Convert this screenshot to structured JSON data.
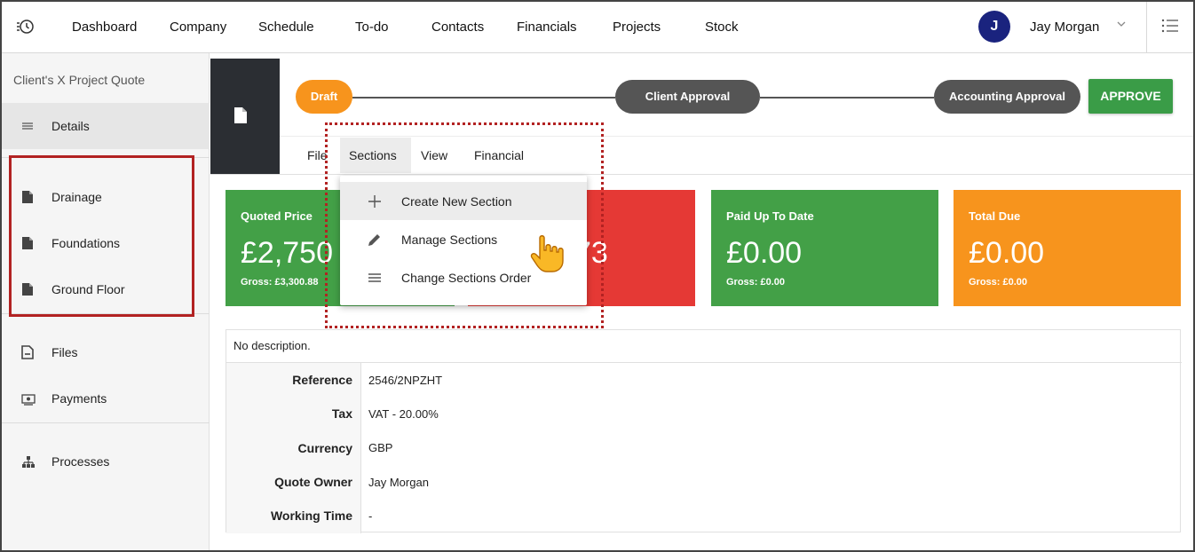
{
  "topbar": {
    "nav": [
      "Dashboard",
      "Company",
      "Schedule",
      "To-do",
      "Contacts",
      "Financials",
      "Projects",
      "Stock"
    ],
    "avatar_initial": "J",
    "user_name": "Jay Morgan",
    "icons": {
      "history": "history-icon",
      "user_menu": "chevron-down-icon",
      "app_menu": "list-menu-icon"
    }
  },
  "sidebar": {
    "project_title": "Client's X Project Quote",
    "details_label": "Details",
    "sections": [
      "Drainage",
      "Foundations",
      "Ground Floor"
    ],
    "files_label": "Files",
    "payments_label": "Payments",
    "processes_label": "Processes"
  },
  "workflow": {
    "stages": [
      "Draft",
      "Client Approval",
      "Accounting Approval"
    ],
    "current_stage": "Draft",
    "approve_label": "APPROVE"
  },
  "menu": {
    "tabs": [
      "File",
      "Sections",
      "View",
      "Financial"
    ],
    "active_tab": "Sections",
    "dropdown": [
      "Create New Section",
      "Manage Sections",
      "Change Sections Order"
    ]
  },
  "cards": [
    {
      "title": "Quoted Price",
      "value": "£2,750",
      "gross": "Gross: £3,300.88",
      "color": "#43a047"
    },
    {
      "title": "",
      "value": "73",
      "gross": "",
      "color": "#e53935"
    },
    {
      "title": "Paid Up To Date",
      "value": "£0.00",
      "gross": "Gross: £0.00",
      "color": "#43a047"
    },
    {
      "title": "Total Due",
      "value": "£0.00",
      "gross": "Gross: £0.00",
      "color": "#f7941d"
    }
  ],
  "details": {
    "description": "No description.",
    "rows": [
      {
        "label": "Reference",
        "value": "2546/2NPZHT"
      },
      {
        "label": "Tax",
        "value": "VAT - 20.00%"
      },
      {
        "label": "Currency",
        "value": "GBP"
      },
      {
        "label": "Quote Owner",
        "value": "Jay Morgan"
      },
      {
        "label": "Working Time",
        "value": "-"
      }
    ]
  },
  "colors": {
    "accent_orange": "#f7941d",
    "approve_green": "#3a9c47",
    "annotation_red": "#b22222",
    "avatar_navy": "#1a237e"
  }
}
